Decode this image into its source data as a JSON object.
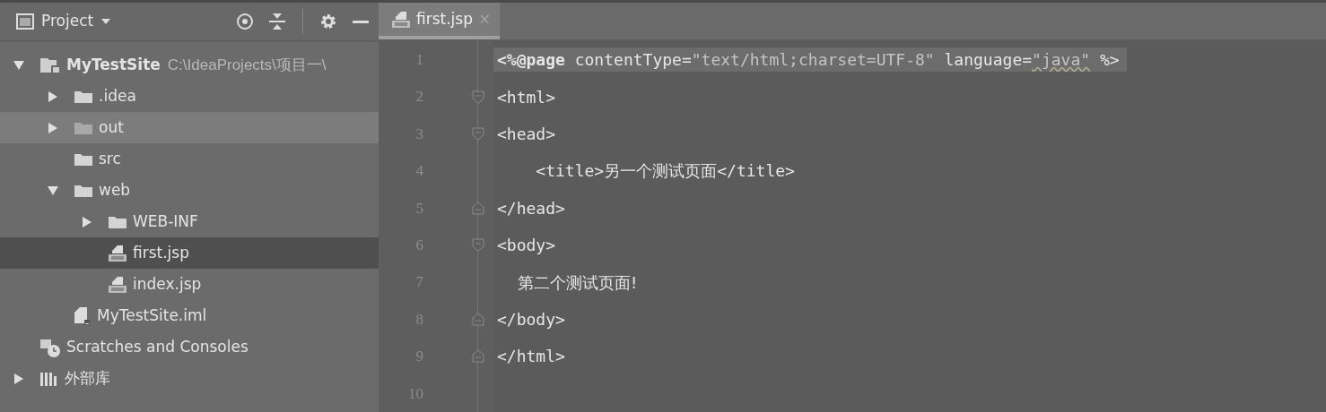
{
  "project_panel": {
    "title": "Project",
    "tree": [
      {
        "label": "MyTestSite",
        "path": "C:\\IdeaProjects\\项目一\\",
        "kind": "module",
        "expanded": true,
        "selected": false,
        "hovered": false,
        "children": [
          {
            "label": ".idea",
            "kind": "folder",
            "expanded": false,
            "selected": false,
            "hovered": false
          },
          {
            "label": "out",
            "kind": "excluded",
            "expanded": false,
            "selected": false,
            "hovered": true
          },
          {
            "label": "src",
            "kind": "folder",
            "selected": false,
            "hovered": false
          },
          {
            "label": "web",
            "kind": "folder",
            "expanded": true,
            "selected": false,
            "hovered": false,
            "children": [
              {
                "label": "WEB-INF",
                "kind": "folder",
                "expanded": false,
                "selected": false,
                "hovered": false
              },
              {
                "label": "first.jsp",
                "kind": "jsp",
                "selected": true,
                "hovered": false
              },
              {
                "label": "index.jsp",
                "kind": "jsp",
                "selected": false,
                "hovered": false
              }
            ]
          },
          {
            "label": "MyTestSite.iml",
            "kind": "iml",
            "selected": false,
            "hovered": false
          }
        ]
      },
      {
        "label": "Scratches and Consoles",
        "kind": "scratches",
        "selected": false,
        "hovered": false
      },
      {
        "label": "外部库",
        "kind": "library",
        "expanded": false,
        "selected": false,
        "hovered": false
      }
    ]
  },
  "editor": {
    "tabs": [
      {
        "label": "first.jsp",
        "close": "×",
        "selected": true
      }
    ],
    "lines": [
      {
        "number": "1",
        "current": true,
        "kind": "plain",
        "tokens": [
          {
            "kind": "directive",
            "text": "<%@page"
          },
          {
            "kind": "attr",
            "text": " contentType="
          },
          {
            "kind": "string",
            "text": "\"text/html;charset=UTF-8\""
          },
          {
            "kind": "attr",
            "text": " language="
          },
          {
            "kind": "warning",
            "text": "\"java\""
          },
          {
            "kind": "attr",
            "text": " %>"
          }
        ]
      },
      {
        "number": "2",
        "current": false,
        "kind": "fold-start",
        "tokens": [
          {
            "kind": "tag",
            "text": "<html>"
          }
        ]
      },
      {
        "number": "3",
        "current": false,
        "kind": "fold-start",
        "tokens": [
          {
            "kind": "tag",
            "text": "<head>"
          }
        ]
      },
      {
        "number": "4",
        "current": false,
        "kind": "plain",
        "tokens": [
          {
            "kind": "tag",
            "text": "    <title>"
          },
          {
            "kind": "text",
            "text": "另一个测试页面"
          },
          {
            "kind": "tag",
            "text": "</title>"
          }
        ]
      },
      {
        "number": "5",
        "current": false,
        "kind": "fold-end",
        "tokens": [
          {
            "kind": "tag",
            "text": "</head>"
          }
        ]
      },
      {
        "number": "6",
        "current": false,
        "kind": "fold-start",
        "tokens": [
          {
            "kind": "tag",
            "text": "<body>"
          }
        ]
      },
      {
        "number": "7",
        "current": false,
        "kind": "plain",
        "tokens": [
          {
            "kind": "text",
            "text": "    第二个测试页面!"
          }
        ]
      },
      {
        "number": "8",
        "current": false,
        "kind": "fold-end",
        "tokens": [
          {
            "kind": "tag",
            "text": "</body>"
          }
        ]
      },
      {
        "number": "9",
        "current": false,
        "kind": "fold-end",
        "tokens": [
          {
            "kind": "tag",
            "text": "</html>"
          }
        ]
      },
      {
        "number": "10",
        "kind": "plain"
      }
    ]
  }
}
